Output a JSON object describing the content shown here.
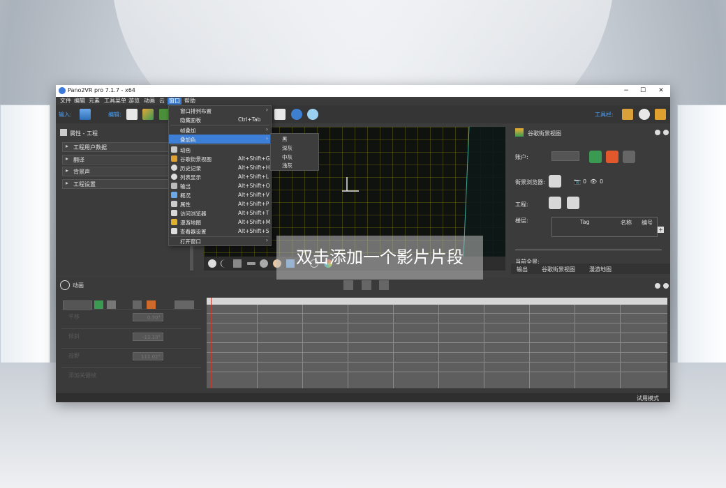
{
  "window": {
    "title": "Pano2VR pro 7.1.7 - x64",
    "min": "−",
    "max": "☐",
    "close": "✕"
  },
  "menubar": [
    "文件",
    "编辑",
    "元素",
    "工具菜单",
    "游览",
    "动画",
    "云",
    "窗口",
    "帮助"
  ],
  "toolbar": {
    "input_label": "输入:",
    "edit_label": "编辑:",
    "toolbar_label": "工具栏:"
  },
  "left_panel": {
    "title": "属性 - 工程",
    "sections": [
      "工程用户数据",
      "翻译",
      "背景声",
      "工程设置"
    ]
  },
  "right_panel": {
    "title": "谷歌街景视图",
    "account_label": "账户:",
    "browser_label": "街景浏览器:",
    "photo_count": "0",
    "view_count": "0",
    "project_label": "工程:",
    "floor_label": "楼层:",
    "table_headers": [
      "Tag",
      "名称",
      "编号"
    ],
    "current_label": "当前全景:",
    "tabs": [
      "输出",
      "谷歌街景视图",
      "漫游地图"
    ]
  },
  "window_menu": {
    "items": [
      {
        "label": "窗口排列布置",
        "shortcut": "",
        "arrow": "›",
        "icon": ""
      },
      {
        "label": "隐藏面板",
        "shortcut": "Ctrl+Tab",
        "arrow": "",
        "icon": ""
      },
      {
        "label": "帧叠加",
        "shortcut": "",
        "arrow": "›",
        "icon": ""
      },
      {
        "label": "叠加色",
        "shortcut": "",
        "arrow": "›",
        "icon": "",
        "highlight": true
      },
      {
        "label": "动画",
        "shortcut": "",
        "arrow": "",
        "icon": "film"
      },
      {
        "label": "谷歌街景视图",
        "shortcut": "Alt+Shift+G",
        "arrow": "",
        "icon": "streetview"
      },
      {
        "label": "历史记录",
        "shortcut": "Alt+Shift+H",
        "arrow": "",
        "icon": "history"
      },
      {
        "label": "列表显示",
        "shortcut": "Alt+Shift+L",
        "arrow": "",
        "icon": "list"
      },
      {
        "label": "输出",
        "shortcut": "Alt+Shift+O",
        "arrow": "",
        "icon": "output"
      },
      {
        "label": "概况",
        "shortcut": "Alt+Shift+V",
        "arrow": "",
        "icon": "overview"
      },
      {
        "label": "属性",
        "shortcut": "Alt+Shift+P",
        "arrow": "",
        "icon": "properties"
      },
      {
        "label": "访问浏览器",
        "shortcut": "Alt+Shift+T",
        "arrow": "",
        "icon": "browser"
      },
      {
        "label": "漫游地图",
        "shortcut": "Alt+Shift+M",
        "arrow": "",
        "icon": "map"
      },
      {
        "label": "查看器设置",
        "shortcut": "Alt+Shift+S",
        "arrow": "",
        "icon": "viewer"
      },
      {
        "label": "打开窗口",
        "shortcut": "",
        "arrow": "›",
        "icon": ""
      }
    ],
    "submenu": [
      "黑",
      "深灰",
      "中灰",
      "浅灰"
    ]
  },
  "animation": {
    "title": "动画",
    "tracks": [
      {
        "label": "平移",
        "value": "0.70°"
      },
      {
        "label": "倾斜",
        "value": "-13.10°"
      },
      {
        "label": "视野",
        "value": "111.02°"
      },
      {
        "label": "添加关键帧",
        "value": ""
      }
    ]
  },
  "overlay_text": "双击添加一个影片片段",
  "status": "试用模式",
  "colors": {
    "accent": "#3d7fd6",
    "grid": "#c8c800"
  }
}
